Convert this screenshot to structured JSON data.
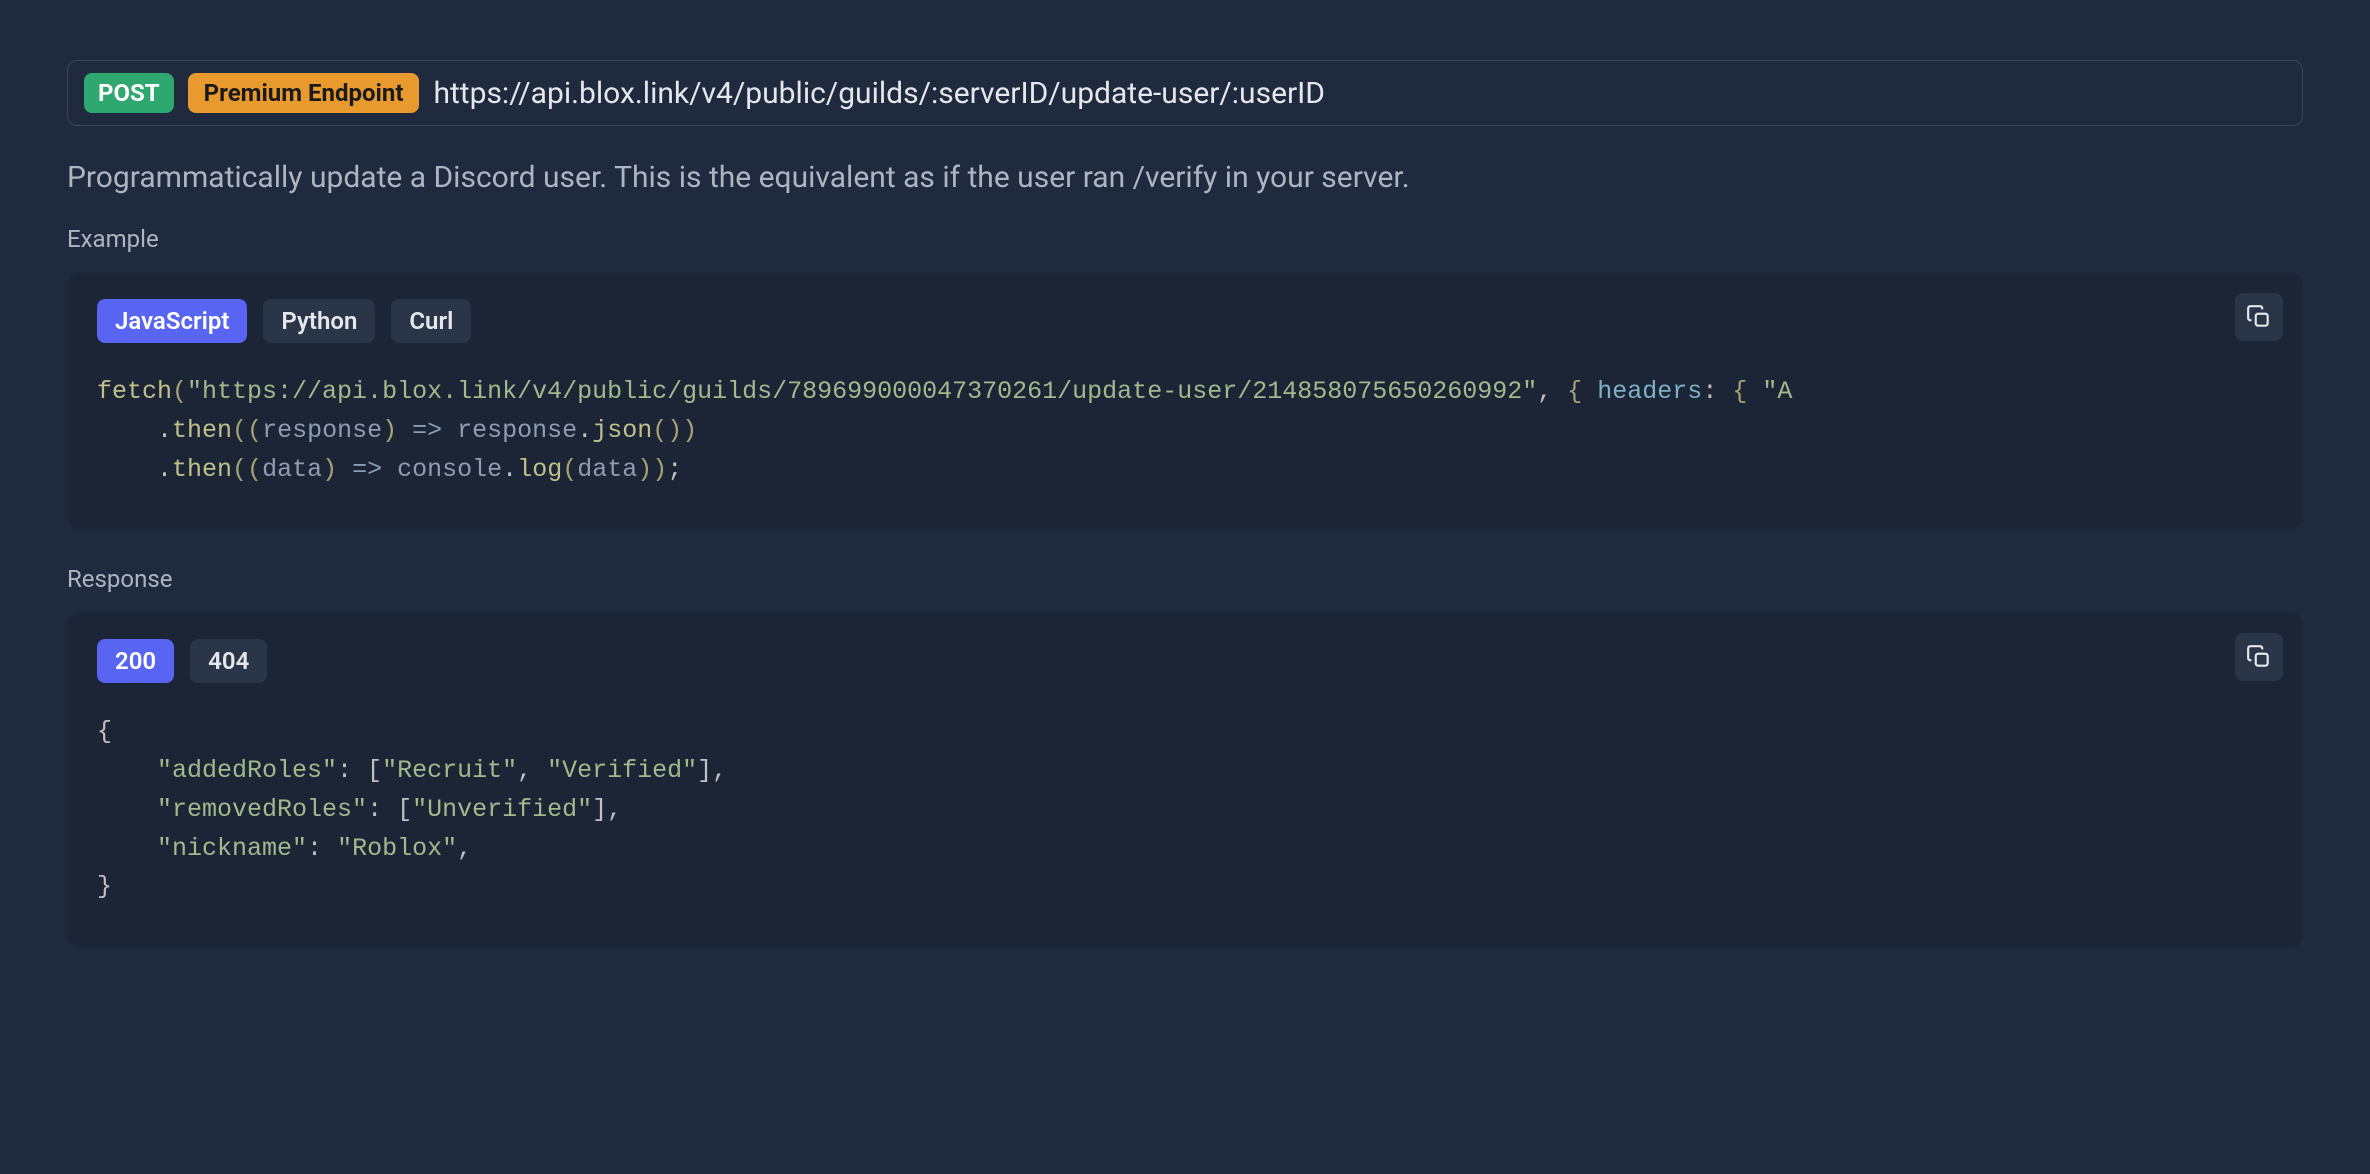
{
  "endpoint": {
    "method": "POST",
    "premium_label": "Premium Endpoint",
    "url": "https://api.blox.link/v4/public/guilds/:serverID/update-user/:userID"
  },
  "description": "Programmatically update a Discord user. This is the equivalent as if the user ran /verify in your server.",
  "example": {
    "label": "Example",
    "tabs": [
      "JavaScript",
      "Python",
      "Curl"
    ],
    "active_tab": "JavaScript",
    "code": {
      "fetch_fn": "fetch",
      "url_str": "\"https://api.blox.link/v4/public/guilds/789699000047370261/update-user/214858075650260992\"",
      "headers_key": "headers",
      "headers_open": "{ ",
      "auth_partial": "\"A",
      "then1_response": "response",
      "then1_json": "json",
      "then2_data": "data",
      "console": "console",
      "log": "log"
    }
  },
  "response": {
    "label": "Response",
    "tabs": [
      "200",
      "404"
    ],
    "active_tab": "200",
    "json": {
      "addedRoles_key": "\"addedRoles\"",
      "addedRoles_v1": "\"Recruit\"",
      "addedRoles_v2": "\"Verified\"",
      "removedRoles_key": "\"removedRoles\"",
      "removedRoles_v1": "\"Unverified\"",
      "nickname_key": "\"nickname\"",
      "nickname_val": "\"Roblox\""
    }
  }
}
